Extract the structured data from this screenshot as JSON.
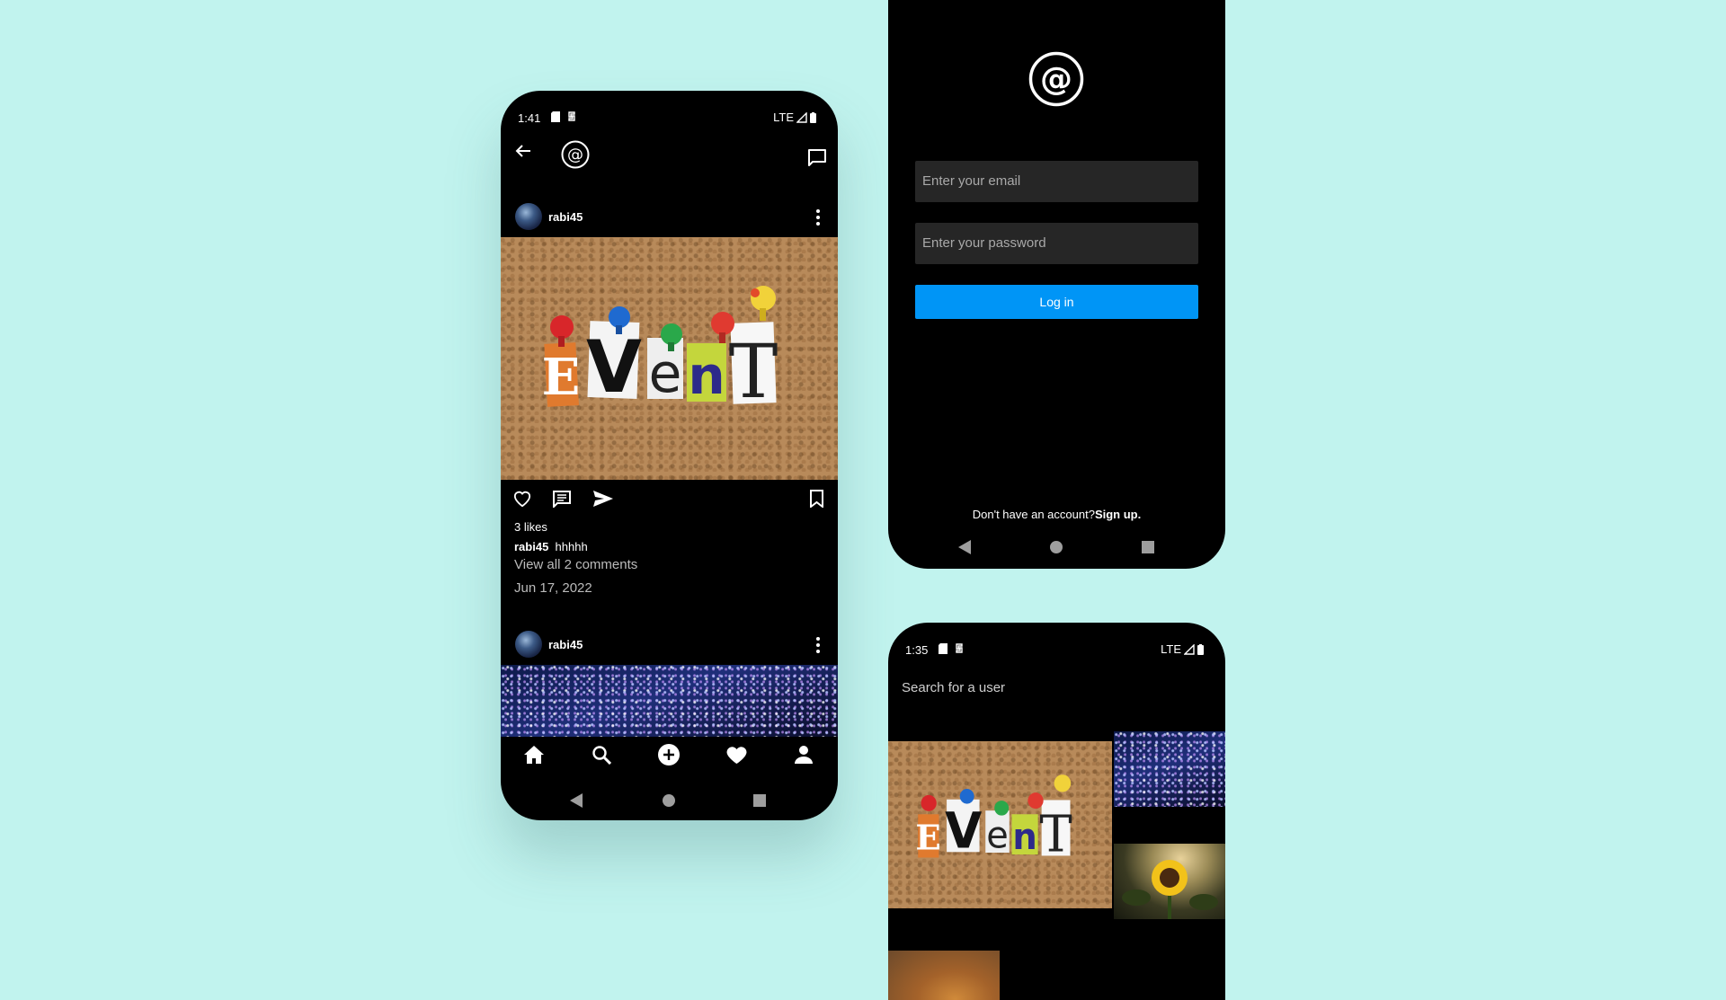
{
  "colors": {
    "background": "#c1f3ee",
    "phone": "#000000",
    "accent": "#0095f6",
    "input": "#262626"
  },
  "feed": {
    "status": {
      "time": "1:41",
      "network": "LTE"
    },
    "posts": [
      {
        "username": "rabi45",
        "likes": "3 likes",
        "caption_user": "rabi45",
        "caption_text": "hhhhh",
        "comments_link": "View all 2 comments",
        "date": "Jun 17, 2022",
        "image_text": [
          "E",
          "V",
          "e",
          "n",
          "T"
        ]
      },
      {
        "username": "rabi45"
      }
    ],
    "icons": {
      "back": "arrow-left-icon",
      "logo": "at-sign-logo-icon",
      "messages": "chat-icon",
      "like": "heart-icon",
      "comment": "comment-icon",
      "share": "send-icon",
      "save": "bookmark-icon"
    },
    "bottom_nav": [
      "home-icon",
      "search-icon",
      "add-icon",
      "heart-icon",
      "profile-icon"
    ]
  },
  "login": {
    "email_placeholder": "Enter your email",
    "password_placeholder": "Enter your password",
    "button_label": "Log in",
    "signup_prompt": "Don't have an account?",
    "signup_link": "Sign up."
  },
  "search": {
    "status": {
      "time": "1:35",
      "network": "LTE"
    },
    "placeholder": "Search for a user"
  }
}
